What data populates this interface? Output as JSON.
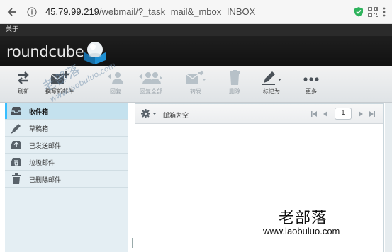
{
  "browser": {
    "url_host": "45.79.99.219",
    "url_path": "/webmail/?_task=mail&_mbox=INBOX"
  },
  "top_strip": {
    "about": "关于"
  },
  "header": {
    "logo": "roundcube"
  },
  "toolbar": {
    "refresh": "刷新",
    "compose": "撰写新邮件",
    "reply": "回复",
    "reply_all": "回复全部",
    "forward": "转发",
    "delete": "删除",
    "mark": "标记为",
    "more": "更多"
  },
  "folders": [
    {
      "label": "收件箱",
      "icon": "inbox-icon",
      "selected": true
    },
    {
      "label": "草稿箱",
      "icon": "pencil-icon",
      "selected": false
    },
    {
      "label": "已发送邮件",
      "icon": "sent-icon",
      "selected": false
    },
    {
      "label": "垃圾邮件",
      "icon": "junk-icon",
      "selected": false
    },
    {
      "label": "已删除邮件",
      "icon": "trash-icon",
      "selected": false
    }
  ],
  "message_list": {
    "empty_text": "邮箱为空",
    "page": "1"
  },
  "watermark": {
    "diag_cn": "老部落",
    "diag_url": "www.laobuluo.com",
    "bottom_cn": "老部落",
    "bottom_url": "www.laobuluo.com"
  }
}
